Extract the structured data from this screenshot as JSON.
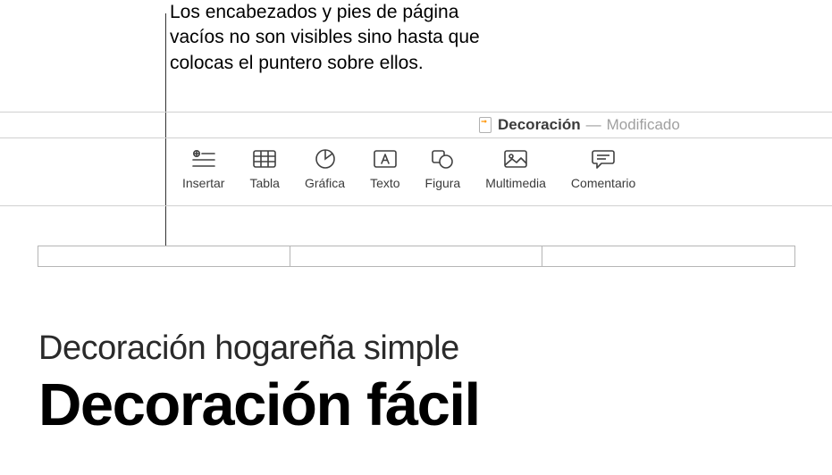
{
  "callout": {
    "text": "Los encabezados y pies de página vacíos no son visibles sino hasta que colocas el puntero sobre ellos."
  },
  "titlebar": {
    "doc_name": "Decoración",
    "separator": "—",
    "status": "Modificado"
  },
  "toolbar": {
    "items": [
      {
        "label": "Insertar",
        "icon": "insert"
      },
      {
        "label": "Tabla",
        "icon": "table"
      },
      {
        "label": "Gráfica",
        "icon": "chart"
      },
      {
        "label": "Texto",
        "icon": "text"
      },
      {
        "label": "Figura",
        "icon": "shape"
      },
      {
        "label": "Multimedia",
        "icon": "media"
      },
      {
        "label": "Comentario",
        "icon": "comment"
      }
    ]
  },
  "document": {
    "subtitle": "Decoración hogareña simple",
    "title": "Decoración fácil"
  }
}
